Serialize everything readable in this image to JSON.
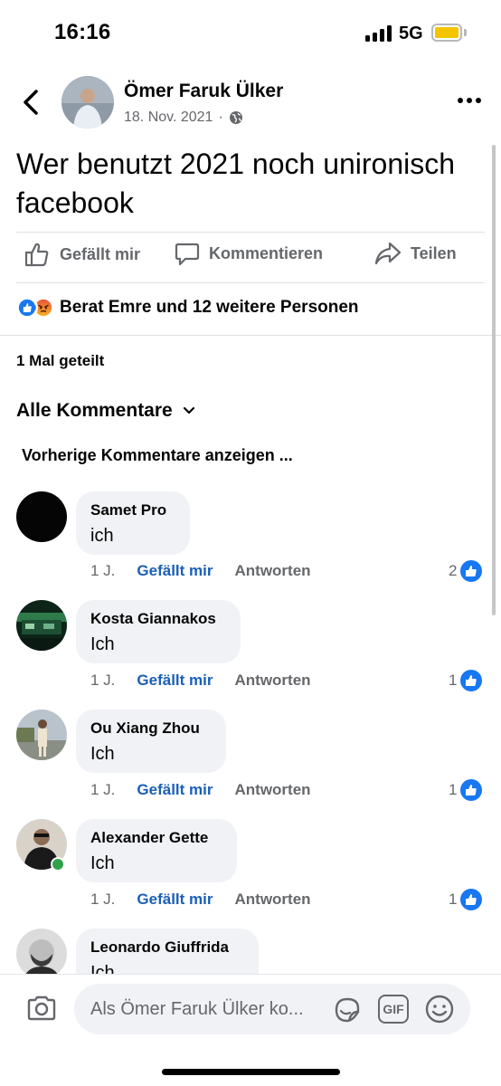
{
  "status_bar": {
    "time": "16:16",
    "network": "5G",
    "colors": {
      "battery": "#f5c400"
    }
  },
  "post": {
    "author": "Ömer Faruk Ülker",
    "date": "18. Nov. 2021",
    "privacy_separator": "·",
    "privacy_icon": "globe-icon",
    "text": "Wer benutzt 2021 noch unironisch facebook"
  },
  "actions": {
    "like": "Gefällt mir",
    "comment": "Kommentieren",
    "share": "Teilen"
  },
  "reactions": {
    "text": "Berat Emre und 12 weitere Personen",
    "icons": [
      "like-reaction-icon",
      "angry-reaction-icon"
    ]
  },
  "shares": "1 Mal geteilt",
  "filter": {
    "label": "Alle Kommentare"
  },
  "previous_comments": "Vorherige Kommentare anzeigen ...",
  "comments": [
    {
      "name": "Samet Pro",
      "text": "ich",
      "age": "1 J.",
      "like": "Gefällt mir",
      "reply": "Antworten",
      "likes": "2"
    },
    {
      "name": "Kosta Giannakos",
      "text": "Ich",
      "age": "1 J.",
      "like": "Gefällt mir",
      "reply": "Antworten",
      "likes": "1"
    },
    {
      "name": "Ou Xiang Zhou",
      "text": "Ich",
      "age": "1 J.",
      "like": "Gefällt mir",
      "reply": "Antworten",
      "likes": "1"
    },
    {
      "name": "Alexander Gette",
      "text": "Ich",
      "age": "1 J.",
      "like": "Gefällt mir",
      "reply": "Antworten",
      "likes": "1"
    },
    {
      "name": "Leonardo Giuffrida",
      "text": "Ich"
    }
  ],
  "composer": {
    "placeholder": "Als Ömer Faruk Ülker ko...",
    "gif_label": "GIF"
  },
  "colors": {
    "link_blue": "#1b5fb7",
    "like_blue": "#1877f2",
    "bubble": "#f0f2f5",
    "muted": "#65676b"
  }
}
